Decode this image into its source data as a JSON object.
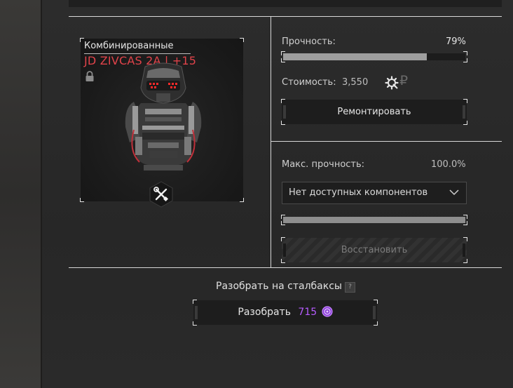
{
  "item": {
    "category": "Комбинированные",
    "name": "JD ZIVCAS 2A | +15"
  },
  "repair": {
    "durability_label": "Прочность:",
    "durability_value": "79%",
    "durability_fraction": 0.79,
    "cost_label": "Стоимость:",
    "cost_value": "3,550",
    "currency_glyph": "₽",
    "repair_button": "Ремонтировать"
  },
  "restore": {
    "max_durability_label": "Макс. прочность:",
    "max_durability_value": "100.0%",
    "max_durability_fraction": 1.0,
    "component_select_value": "Нет доступных компонентов",
    "restore_button": "Восстановить"
  },
  "disassemble": {
    "title": "Разобрать на сталбаксы",
    "help_glyph": "?",
    "button_label": "Разобрать",
    "amount": "715"
  },
  "colors": {
    "accent_red": "#e0434a",
    "purple": "#b65cff"
  },
  "icons": [
    "lock-icon",
    "wrench-screwdriver-icon",
    "gear-icon",
    "ruble-icon",
    "chevron-down-icon",
    "help-icon",
    "stalbucks-coin-icon"
  ]
}
